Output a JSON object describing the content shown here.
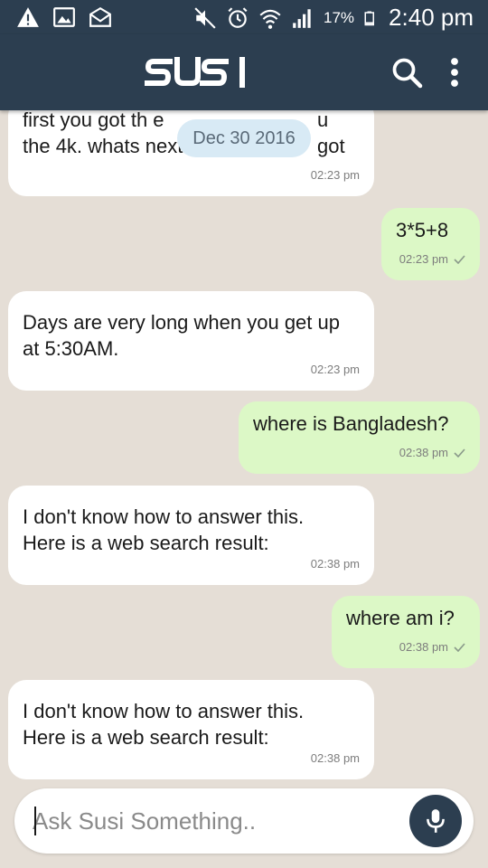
{
  "status_bar": {
    "battery_text": "17%",
    "time": "2:40 pm",
    "icons": [
      "warning-icon",
      "image-icon",
      "mail-icon",
      "mute-icon",
      "alarm-icon",
      "wifi-icon",
      "signal-icon",
      "battery-icon"
    ]
  },
  "app_bar": {
    "logo_text": "SUSI",
    "icons": [
      "search-icon",
      "more-vert-icon"
    ]
  },
  "date_chip": "Dec 30 2016",
  "messages": [
    {
      "side": "in",
      "lines": [
        "first you got th e",
        "the 4k. whats next?"
      ],
      "suffix_line1": "u got",
      "time": "02:23 pm"
    },
    {
      "side": "out",
      "lines": [
        "3*5+8"
      ],
      "time": "02:23 pm",
      "read": true
    },
    {
      "side": "in",
      "lines": [
        "Days are very long when you get up",
        "at 5:30AM."
      ],
      "time": "02:23 pm"
    },
    {
      "side": "out",
      "lines": [
        "where is Bangladesh?"
      ],
      "time": "02:38 pm",
      "read": true
    },
    {
      "side": "in",
      "lines": [
        "I don't know how to answer this.",
        "Here is a web search result:"
      ],
      "time": "02:38 pm"
    },
    {
      "side": "out",
      "lines": [
        "where am i?"
      ],
      "time": "02:38 pm",
      "read": true
    },
    {
      "side": "in",
      "lines": [
        "I don't know how to answer this.",
        "Here is a web search result:"
      ],
      "time": "02:38 pm"
    }
  ],
  "input": {
    "placeholder": "Ask Susi Something..",
    "value": ""
  },
  "colors": {
    "primary": "#2c3e50",
    "incoming_bubble": "#ffffff",
    "outgoing_bubble": "#dcf8c6",
    "background": "#e5ded6",
    "date_chip": "#d8eaf5"
  }
}
